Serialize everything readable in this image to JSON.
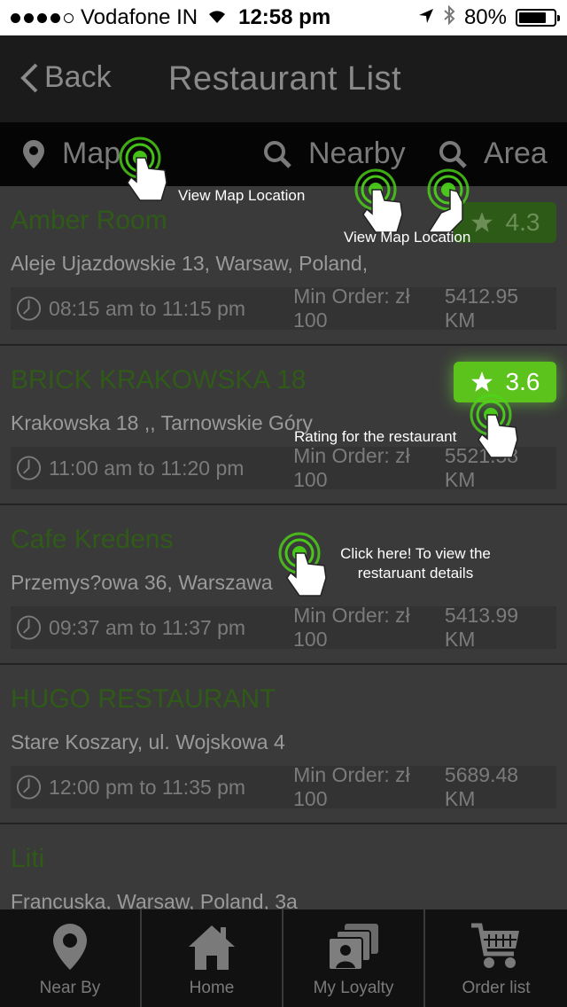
{
  "status": {
    "carrier": "Vodafone IN",
    "time": "12:58 pm",
    "battery": "80%",
    "battery_level": 0.8
  },
  "nav": {
    "back_label": "Back",
    "title": "Restaurant List"
  },
  "filters": {
    "map": "Map",
    "nearby": "Nearby",
    "area": "Area"
  },
  "restaurants": [
    {
      "name": "Amber Room",
      "address": "Aleje Ujazdowskie 13, Warsaw, Poland,",
      "hours": "08:15 am to 11:15 pm",
      "min_order": "Min Order: zł 100",
      "distance": "5412.95 KM",
      "rating": "4.3"
    },
    {
      "name": "BRICK KRAKOWSKA 18",
      "address": "Krakowska 18 ,, Tarnowskie Góry",
      "hours": "11:00 am to 11:20 pm",
      "min_order": "Min Order: zł 100",
      "distance": "5521.58 KM",
      "rating": "3.6"
    },
    {
      "name": "Cafe Kredens",
      "address": "Przemys?owa 36, Warszawa",
      "hours": "09:37 am to 11:37 pm",
      "min_order": "Min Order: zł 100",
      "distance": "5413.99 KM"
    },
    {
      "name": "HUGO RESTAURANT",
      "address": "Stare Koszary, ul. Wojskowa 4",
      "hours": "12:00 pm to 11:35 pm",
      "min_order": "Min Order: zł 100",
      "distance": "5689.48 KM"
    },
    {
      "name": "Liti",
      "address": "Francuska, Warsaw, Poland, 3a"
    }
  ],
  "hints": {
    "map_location_1": "View Map Location",
    "map_location_2": "View Map Location",
    "rating": "Rating for the restaurant",
    "details": "Click here! To view the restaruant details"
  },
  "tabs": {
    "near_by": "Near By",
    "home": "Home",
    "my_loyalty": "My Loyalty",
    "order_list": "Order list"
  },
  "colors": {
    "accent_green": "#5cc31d",
    "name_green": "#2f5a17"
  }
}
